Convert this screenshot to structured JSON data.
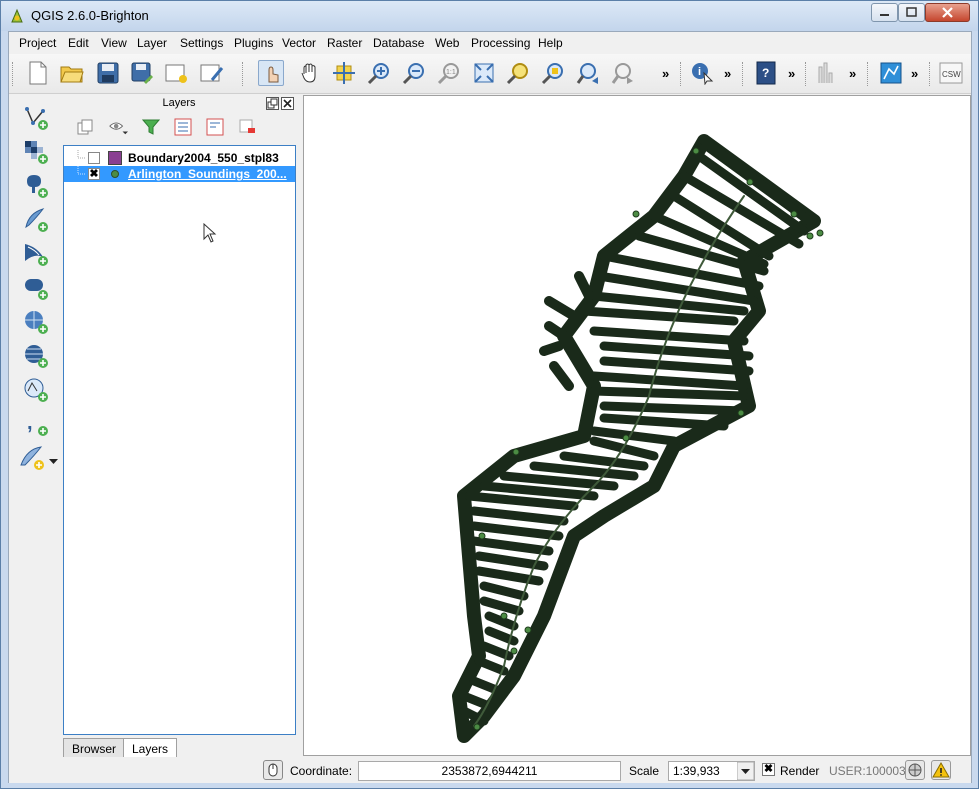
{
  "window": {
    "title": "QGIS 2.6.0-Brighton"
  },
  "menubar": {
    "items": [
      "Project",
      "Edit",
      "View",
      "Layer",
      "Settings",
      "Plugins",
      "Vector",
      "Raster",
      "Database",
      "Web",
      "Processing",
      "Help"
    ]
  },
  "layers_panel": {
    "title": "Layers",
    "layers": [
      {
        "name": "Boundary2004_550_stpl83",
        "checked": false,
        "selected": false,
        "symbol": "polygon",
        "color": "#8a3f92"
      },
      {
        "name": "Arlington_Soundings_200...",
        "checked": true,
        "selected": true,
        "symbol": "point",
        "color": "#4c8c44"
      }
    ],
    "tabs": [
      "Browser",
      "Layers"
    ],
    "active_tab": "Layers"
  },
  "statusbar": {
    "coordinate_label": "Coordinate:",
    "coordinate_value": "2353872,6944211",
    "scale_label": "Scale",
    "scale_value": "1:39,933",
    "render_label": "Render",
    "render_checked": true,
    "crs": "USER:100003"
  },
  "colors": {
    "track": "#1a2a1a",
    "point": "#4c8c44"
  }
}
